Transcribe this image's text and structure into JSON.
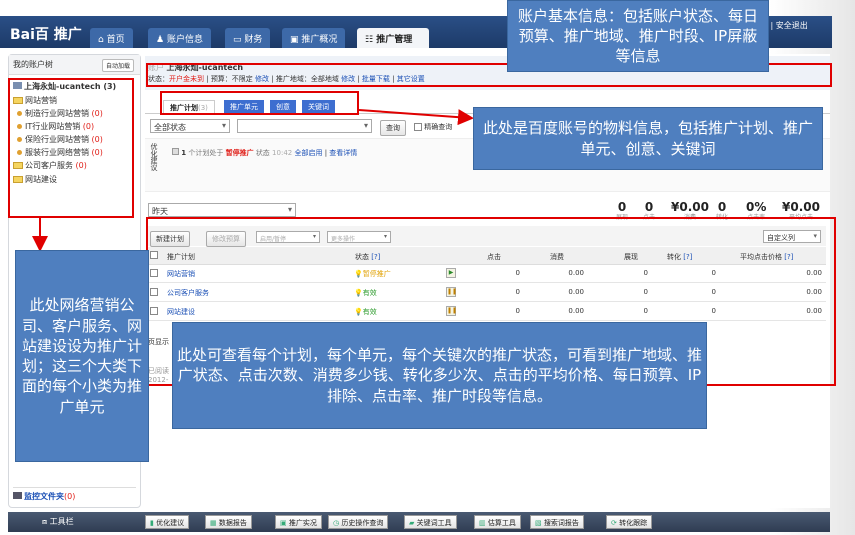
{
  "header": {
    "logo": "Bai百 推广",
    "tabs": [
      "首页",
      "账户信息",
      "财务",
      "推广概况",
      "推广管理"
    ],
    "active_tab": "推广管理",
    "links": "词 | 安全退出"
  },
  "sidebar": {
    "title": "我的账户树",
    "collapse_button": "自动加载",
    "account": "上海永灿-ucantech (3)",
    "tree": [
      {
        "label": "网站营销",
        "type": "plan"
      },
      {
        "label": "制造行业网站营销",
        "count": "(0)",
        "type": "unit"
      },
      {
        "label": "IT行业网站营销",
        "count": "(0)",
        "type": "unit"
      },
      {
        "label": "保险行业网站营销",
        "count": "(0)",
        "type": "unit"
      },
      {
        "label": "服装行业网络营销",
        "count": "(0)",
        "type": "unit"
      },
      {
        "label": "公司客户服务",
        "count": "(0)",
        "type": "plan"
      },
      {
        "label": "网站建设",
        "type": "plan"
      }
    ],
    "monitor": "监控文件夹",
    "monitor_count": "(0)"
  },
  "account": {
    "prefix": "账户",
    "name": "上海永灿-ucantech",
    "status_label": "状态：",
    "status": "开户金未到",
    "budget": "预算：不限定",
    "edit": "修改",
    "region": "推广地域：全部地域",
    "edit2": "修改",
    "batch_download": "批量下载",
    "other_settings": "其它设置"
  },
  "tabs": [
    {
      "label": "推广计划",
      "count": "(3)"
    },
    {
      "label": "推广单元"
    },
    {
      "label": "创意"
    },
    {
      "label": "关键词"
    }
  ],
  "filter": {
    "status": "全部状态",
    "search_value": "",
    "query": "查询",
    "exact": "精确查询"
  },
  "optimize": {
    "side_label": "优化建议",
    "count": "1",
    "text1": "个计划处于",
    "paused": "暂停推广",
    "text2": "状态",
    "time": "10:42",
    "enable_all": "全部启用",
    "view_detail": "查看详情"
  },
  "date_range": "昨天",
  "stats": [
    {
      "value": "0",
      "label": "展现"
    },
    {
      "value": "0",
      "label": "点击"
    },
    {
      "value": "¥0.00",
      "label": "消费"
    },
    {
      "value": "0",
      "label": "转化"
    },
    {
      "value": "0%",
      "label": "点击率"
    },
    {
      "value": "¥0.00",
      "label": "平均点击"
    }
  ],
  "table_toolbar": {
    "new_plan": "新建计划",
    "edit_budget": "修改预算",
    "enable_pause": "启用/暂停",
    "more": "更多操作",
    "custom_columns": "自定义列"
  },
  "table": {
    "headers": [
      "推广计划",
      "状态",
      "点击",
      "消费",
      "展现",
      "转化",
      "平均点击价格"
    ],
    "rows": [
      {
        "plan": "网站营销",
        "status": "暂停推广",
        "status_color": "#e0a000",
        "action": "play",
        "clicks": "0",
        "cost": "0.00",
        "impr": "0",
        "conv": "0",
        "avg": "0.00"
      },
      {
        "plan": "公司客户服务",
        "status": "有效",
        "status_color": "#2a9a2a",
        "action": "pause",
        "clicks": "0",
        "cost": "0.00",
        "impr": "0",
        "conv": "0",
        "avg": "0.00"
      },
      {
        "plan": "网站建设",
        "status": "有效",
        "status_color": "#2a9a2a",
        "action": "pause",
        "clicks": "0",
        "cost": "0.00",
        "impr": "0",
        "conv": "0",
        "avg": "0.00"
      }
    ]
  },
  "partial": {
    "page": "页显示",
    "read": "已阅读",
    "date": "2012-"
  },
  "toolbar": {
    "title": "工具栏",
    "items": [
      "优化建议",
      "数据报告",
      "推广实况",
      "历史操作查询",
      "关键词工具",
      "估算工具",
      "搜索词报告",
      "转化跟踪"
    ]
  },
  "callouts": {
    "account": "账户基本信息：包括账户状态、每日预算、推广地域、推广时段、IP屏蔽等信息",
    "materials": "此处是百度账号的物料信息，包括推广计划、推广单元、创意、关键词",
    "tree": "此处网络营销公司、客户服务、网站建设设为推广计划；这三个大类下面的每个小类为推广单元",
    "table": "此处可查看每个计划，每个单元，每个关键次的推广状态，可看到推广地域、推广状态、点击次数、消费多少钱、转化多少次、点击的平均价格、每日预算、IP排除、点击率、推广时段等信息。"
  },
  "colors": {
    "callout": "#4f7fbf",
    "highlight": "#e00000",
    "header": "#23457a"
  }
}
